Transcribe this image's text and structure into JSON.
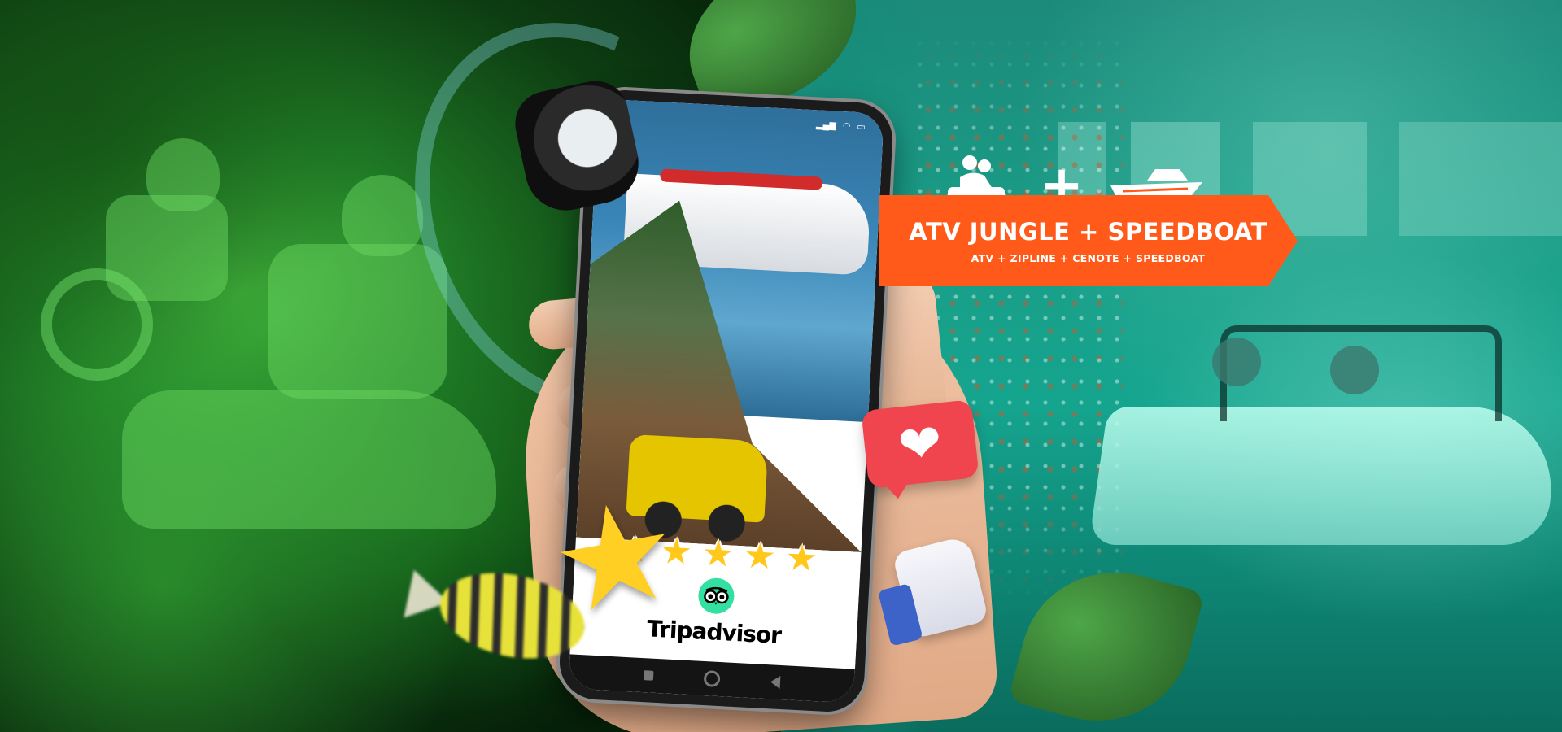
{
  "promo": {
    "title": "ATV JUNGLE + SPEEDBOAT",
    "subtitle": "ATV + ZIPLINE + CENOTE + SPEEDBOAT",
    "plus_symbol": "+",
    "background_color": "#ff5a1a"
  },
  "review": {
    "brand_name": "Tripadvisor",
    "stars": [
      "★",
      "★",
      "★",
      "★",
      "★"
    ],
    "star_rating": 5,
    "logo_icon": "tripadvisor-owl-icon",
    "logo_color": "#34e0a1"
  },
  "decor": {
    "heart_glyph": "❤",
    "big_star_glyph": "★",
    "heart_icon": "heart-icon",
    "thumb_icon": "thumbs-up-icon",
    "atv_icon": "atv-riders-icon",
    "boat_icon": "speedboat-icon"
  },
  "phone": {
    "nav_icons": [
      "recent-apps-icon",
      "home-icon",
      "back-icon"
    ]
  },
  "colors": {
    "left_theme": "#1f7a25",
    "right_theme": "#1a9c86",
    "star": "#ffc81a",
    "heart_bubble": "#f0454f"
  }
}
